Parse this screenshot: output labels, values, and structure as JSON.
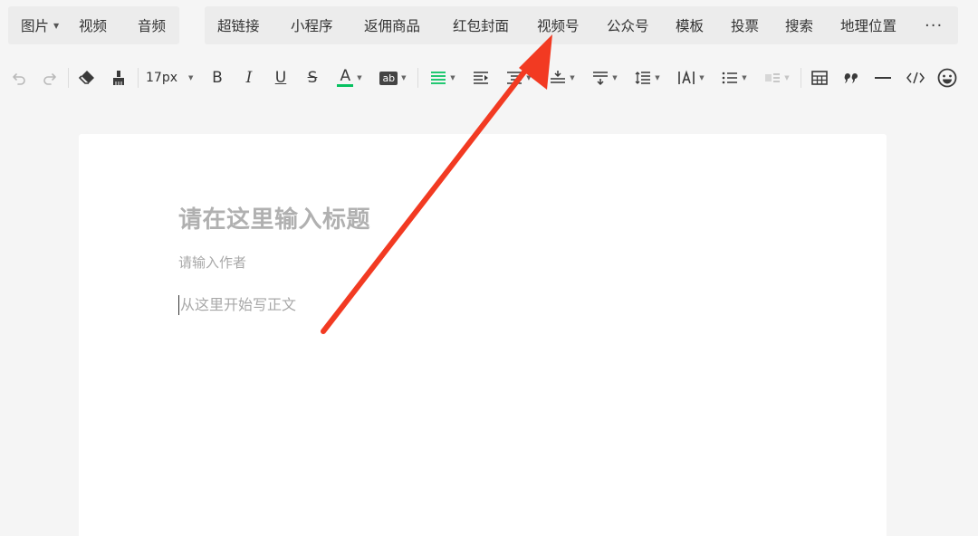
{
  "insert_bar": {
    "left_group": [
      {
        "label": "图片",
        "has_dropdown": true
      },
      {
        "label": "视频",
        "has_dropdown": false
      },
      {
        "label": "音频",
        "has_dropdown": false
      }
    ],
    "right_group": [
      {
        "label": "超链接"
      },
      {
        "label": "小程序"
      },
      {
        "label": "返佣商品"
      },
      {
        "label": "红包封面"
      },
      {
        "label": "视频号"
      },
      {
        "label": "公众号"
      },
      {
        "label": "模板"
      },
      {
        "label": "投票"
      },
      {
        "label": "搜索"
      },
      {
        "label": "地理位置"
      }
    ],
    "more_label": "···"
  },
  "toolbar": {
    "font_size": "17px",
    "bold_label": "B",
    "italic_label": "I",
    "underline_label": "U",
    "strike_label": "S",
    "font_color_label": "A",
    "bg_color_label": "ab",
    "accent_green": "#07c160",
    "font_color_bar": "#07c160"
  },
  "editor": {
    "title_placeholder": "请在这里输入标题",
    "author_placeholder": "请输入作者",
    "body_placeholder": "从这里开始写正文"
  },
  "annotation": {
    "arrow_color": "#f23a22",
    "target": "视频号"
  }
}
